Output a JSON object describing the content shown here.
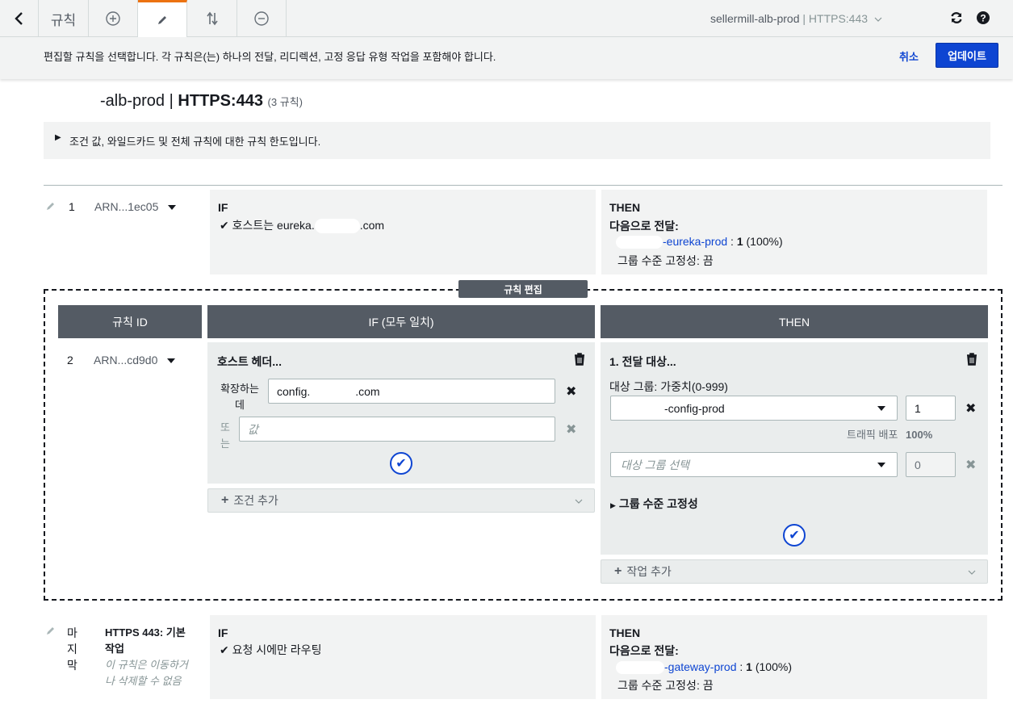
{
  "topbar": {
    "back_icon": "chevron-left-icon",
    "rules_tab": "규칙",
    "add_icon": "plus-circle-icon",
    "edit_icon": "pencil-icon",
    "reorder_icon": "reorder-icon",
    "delete_icon": "minus-circle-icon",
    "listener_name": "sellermill-alb-prod",
    "listener_port": "HTTPS:443",
    "refresh_icon": "refresh-icon",
    "help_icon": "help-icon"
  },
  "subbar": {
    "instruction": "편집할 규칙을 선택합니다. 각 규칙은(는) 하나의 전달, 리디렉션, 고정 응답 유형 작업을 포함해야 합니다.",
    "cancel": "취소",
    "update": "업데이트"
  },
  "page": {
    "title_suffix": "-alb-prod",
    "title_sep": "|",
    "title_port": "HTTPS:443",
    "rule_count": "(3 규칙)",
    "limits_note": "조건 값, 와일드카드 및 전체 규칙에 대한 규칙 한도입니다."
  },
  "rule1": {
    "number": "1",
    "arn": "ARN...1ec05",
    "if_label": "IF",
    "condition_prefix": "호스트는 eureka.",
    "condition_suffix": ".com",
    "then_label": "THEN",
    "action": "다음으로 전달:",
    "target": "-eureka-prod",
    "weight": "1",
    "weight_pct": "(100%)",
    "stickiness": "그룹 수준 고정성: 끔"
  },
  "edit": {
    "badge": "규칙 편집",
    "col_rule_id": "규칙 ID",
    "col_if": "IF (모두 일치)",
    "col_then": "THEN",
    "number": "2",
    "arn": "ARN...cd9d0",
    "condition_title": "호스트 헤더...",
    "extends_label": "확장하는 데",
    "host_value_prefix": "config.",
    "host_value_suffix": ".com",
    "or_label": "또는",
    "value_placeholder": "값",
    "add_condition": "조건 추가",
    "action_title": "1. 전달 대상...",
    "target_group_label": "대상 그룹: 가중치(0-999)",
    "target_group_value": "-config-prod",
    "weight_value": "1",
    "traffic_label": "트래픽 배포",
    "traffic_value": "100%",
    "target_group_placeholder": "대상 그룹 선택",
    "weight_placeholder": "0",
    "stickiness_toggle": "그룹 수준 고정성",
    "add_action": "작업 추가"
  },
  "rule_last": {
    "number": "마지막",
    "name": "HTTPS 443: 기본 작업",
    "note": "이 규칙은 이동하거나 삭제할 수 없음",
    "if_label": "IF",
    "condition": "요청 시에만 라우팅",
    "then_label": "THEN",
    "action": "다음으로 전달:",
    "target": "-gateway-prod",
    "weight": "1",
    "weight_pct": "(100%)",
    "stickiness": "그룹 수준 고정성: 끔"
  },
  "colors": {
    "primary": "#0e45d2",
    "header_gray": "#545b64",
    "panel_bg": "#f2f3f3",
    "active_tab": "#ec7211"
  }
}
